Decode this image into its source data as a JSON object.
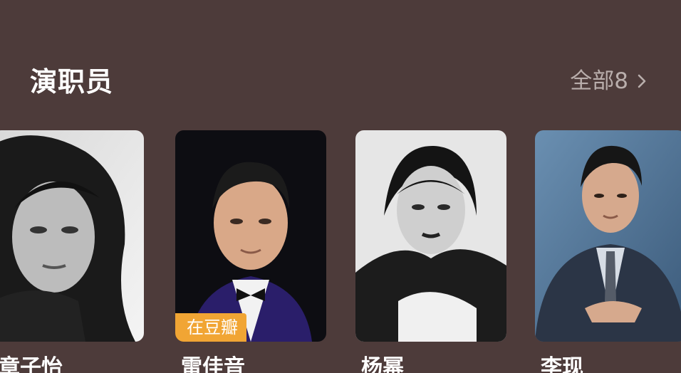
{
  "section": {
    "title": "演职员",
    "see_all_label": "全部8"
  },
  "cast": [
    {
      "name": "章子怡",
      "photo_style": "grayscale"
    },
    {
      "name": "雷佳音",
      "photo_style": "color",
      "badge": "在豆瓣"
    },
    {
      "name": "杨幂",
      "photo_style": "grayscale"
    },
    {
      "name": "李现",
      "photo_style": "color"
    }
  ],
  "colors": {
    "background": "#4d3b3a",
    "badge": "#f1a534",
    "muted_text": "#b9aeac"
  },
  "icons": {
    "see_all": "chevron-right-icon"
  }
}
